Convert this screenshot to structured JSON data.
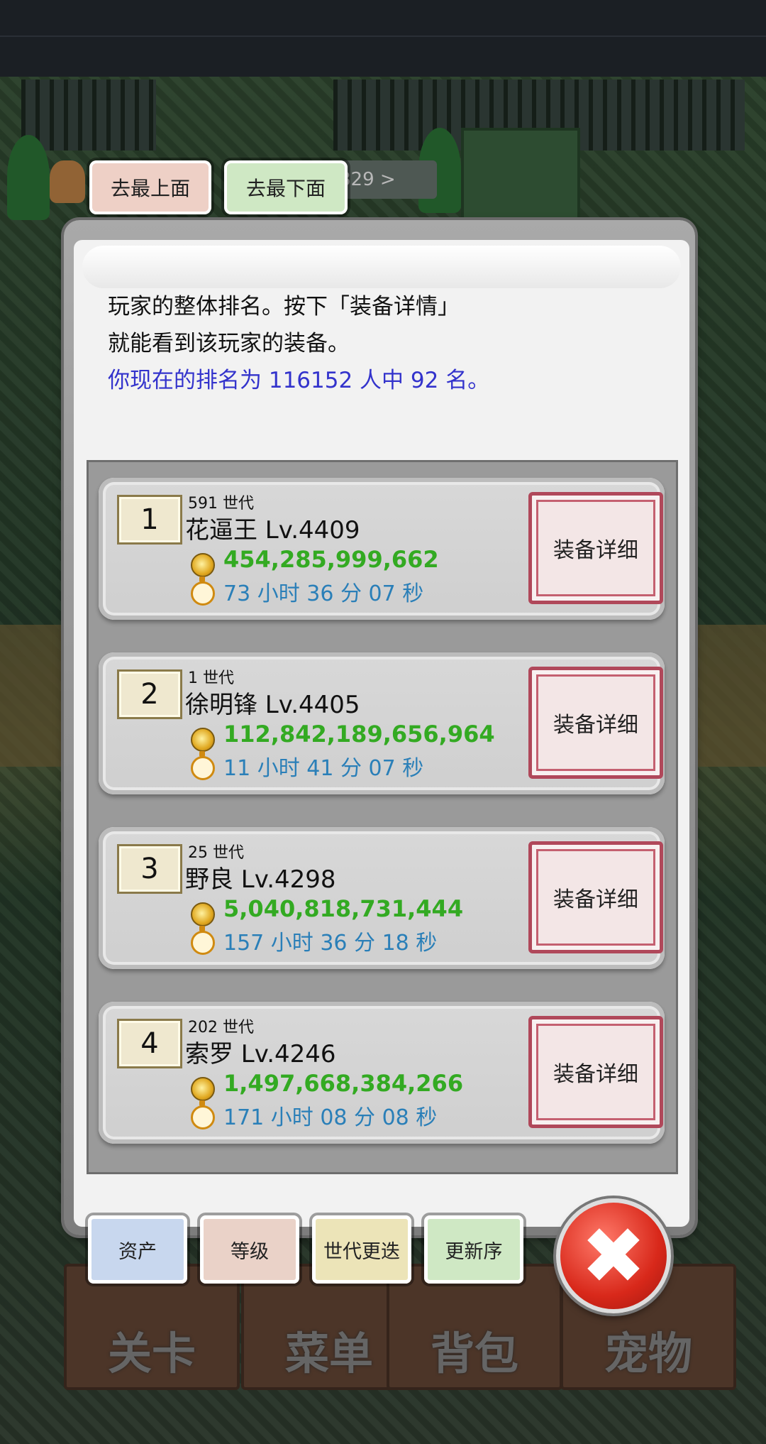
{
  "scroll_buttons": {
    "top": "去最上面",
    "bottom": "去最下面"
  },
  "background_partial": "829 >",
  "intro": {
    "line1": "玩家的整体排名。按下「装备详情」",
    "line2": "就能看到该玩家的装备。",
    "line3": "你现在的排名为 116152 人中 92 名。"
  },
  "rankings": [
    {
      "rank": "1",
      "generation": "591 世代",
      "name": "花逼王 Lv.4409",
      "coins": "454,285,999,662",
      "time": "73 小时 36 分 07 秒",
      "detail": "装备详细"
    },
    {
      "rank": "2",
      "generation": "1 世代",
      "name": "徐明锋 Lv.4405",
      "coins": "112,842,189,656,964",
      "time": "11 小时 41 分 07 秒",
      "detail": "装备详细"
    },
    {
      "rank": "3",
      "generation": "25 世代",
      "name": "野良 Lv.4298",
      "coins": "5,040,818,731,444",
      "time": "157 小时 36 分 18 秒",
      "detail": "装备详细"
    },
    {
      "rank": "4",
      "generation": "202 世代",
      "name": "索罗 Lv.4246",
      "coins": "1,497,668,384,266",
      "time": "171 小时 08 分 08 秒",
      "detail": "装备详细"
    }
  ],
  "sort_buttons": {
    "asset": "资产",
    "level": "等级",
    "generation": "世代更迭",
    "update": "更新序"
  },
  "close_label": "✖",
  "bottom_nav": [
    "关卡",
    "菜单",
    "背包",
    "宠物"
  ],
  "colors": {
    "coins": "#33aa22",
    "time": "#2a7fb8",
    "highlight": "#3333cc",
    "detail_border": "#b0485a"
  }
}
